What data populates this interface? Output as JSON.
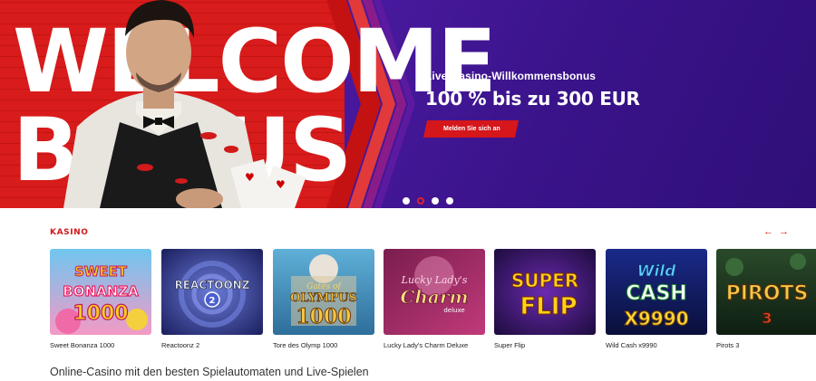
{
  "hero": {
    "big_line1": "WELCOME",
    "big_line2": "BONUS",
    "promo_subtitle": "Live-Casino-Willkommensbonus",
    "promo_title": "100 % bis zu 300 EUR",
    "cta_label": "Melden Sie sich an",
    "slides": 4,
    "active_slide": 2
  },
  "section": {
    "title": "KASINO",
    "prev_icon": "←",
    "next_icon": "→"
  },
  "games": [
    {
      "name": "Sweet Bonanza 1000",
      "art": "SWEET BONANZA 1000"
    },
    {
      "name": "Reactoonz 2",
      "art": "REACTOONZ 2"
    },
    {
      "name": "Tore des Olymp 1000",
      "art": "Gates of OLYMPUS 1000"
    },
    {
      "name": "Lucky Lady's Charm Deluxe",
      "art": "Lucky Lady's Charm deluxe"
    },
    {
      "name": "Super Flip",
      "art": "SUPER FLIP"
    },
    {
      "name": "Wild Cash x9990",
      "art": "Wild CASH X9990"
    },
    {
      "name": "Pirots 3",
      "art": "PIROTS 3"
    }
  ],
  "footer": {
    "heading": "Online-Casino mit den besten Spielautomaten und Live-Spielen"
  },
  "colors": {
    "brand_red": "#d5161b",
    "hero_purple": "#3a138a",
    "text": "#222222"
  }
}
